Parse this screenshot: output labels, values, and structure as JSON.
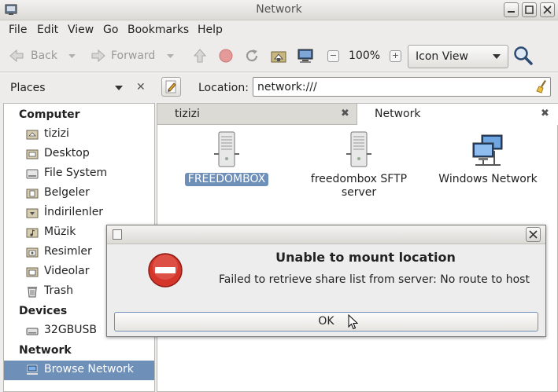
{
  "window": {
    "title": "Network"
  },
  "menu": [
    "File",
    "Edit",
    "View",
    "Go",
    "Bookmarks",
    "Help"
  ],
  "toolbar": {
    "back_label": "Back",
    "forward_label": "Forward",
    "zoom_level": "100%",
    "view_mode": "Icon View"
  },
  "places": {
    "header": "Places"
  },
  "location": {
    "label": "Location:",
    "value": "network:///"
  },
  "sidebar": {
    "sections": [
      {
        "title": "Computer",
        "items": [
          {
            "label": "tizizi",
            "icon": "home-folder-icon"
          },
          {
            "label": "Desktop",
            "icon": "desktop-folder-icon"
          },
          {
            "label": "File System",
            "icon": "drive-icon"
          },
          {
            "label": "Belgeler",
            "icon": "documents-folder-icon"
          },
          {
            "label": "İndirilenler",
            "icon": "downloads-folder-icon"
          },
          {
            "label": "Müzik",
            "icon": "music-folder-icon"
          },
          {
            "label": "Resimler",
            "icon": "pictures-folder-icon"
          },
          {
            "label": "Videolar",
            "icon": "videos-folder-icon"
          },
          {
            "label": "Trash",
            "icon": "trash-icon"
          }
        ]
      },
      {
        "title": "Devices",
        "items": [
          {
            "label": "32GBUSB",
            "icon": "usb-drive-icon"
          }
        ]
      },
      {
        "title": "Network",
        "items": [
          {
            "label": "Browse Network",
            "icon": "network-icon",
            "selected": true
          }
        ]
      }
    ]
  },
  "tabs": [
    {
      "label": "tizizi",
      "active": false
    },
    {
      "label": "Network",
      "active": true
    }
  ],
  "files": [
    {
      "label": "FREEDOMBOX",
      "icon": "server-icon",
      "selected": true
    },
    {
      "label_lines": [
        "freedombox SFTP",
        "server"
      ],
      "icon": "server-icon",
      "selected": false
    },
    {
      "label": "Windows Network",
      "icon": "windows-network-icon",
      "selected": false
    }
  ],
  "dialog": {
    "heading": "Unable to mount location",
    "message": "Failed to retrieve share list from server: No route to host",
    "ok_label": "OK"
  },
  "colors": {
    "selection": "#6e8fb8",
    "error_red": "#d4362c"
  }
}
